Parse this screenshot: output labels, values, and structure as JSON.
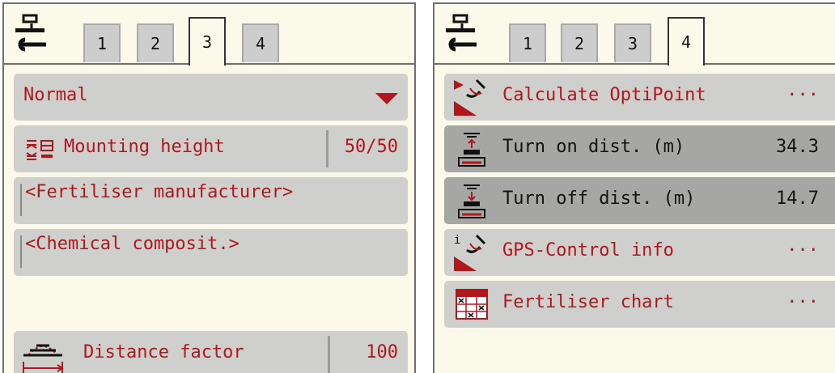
{
  "left_panel": {
    "tabs": [
      "1",
      "2",
      "3",
      "4"
    ],
    "active_tab": "3",
    "dropdown": {
      "value": "Normal"
    },
    "mounting_height": {
      "label": "Mounting height",
      "value": "50/50"
    },
    "fertiliser_manufacturer": {
      "placeholder": "<Fertiliser manufacturer>"
    },
    "chemical_composition": {
      "placeholder": "<Chemical composit.>"
    },
    "distance_factor": {
      "label": "Distance factor",
      "value": "100"
    }
  },
  "right_panel": {
    "tabs": [
      "1",
      "2",
      "3",
      "4"
    ],
    "active_tab": "4",
    "items": [
      {
        "label": "Calculate OptiPoint",
        "value": "···"
      },
      {
        "label": "Turn on dist. (m)",
        "value": "34.3"
      },
      {
        "label": "Turn off dist. (m)",
        "value": "14.7"
      },
      {
        "label": "GPS-Control info",
        "value": "···"
      },
      {
        "label": "Fertiliser chart",
        "value": "···"
      }
    ]
  },
  "colors": {
    "panel_bg": "#fbf9e9",
    "row_bg": "#cfcfcd",
    "row_selected_bg": "#a6a6a4",
    "accent_red": "#b0171d"
  }
}
